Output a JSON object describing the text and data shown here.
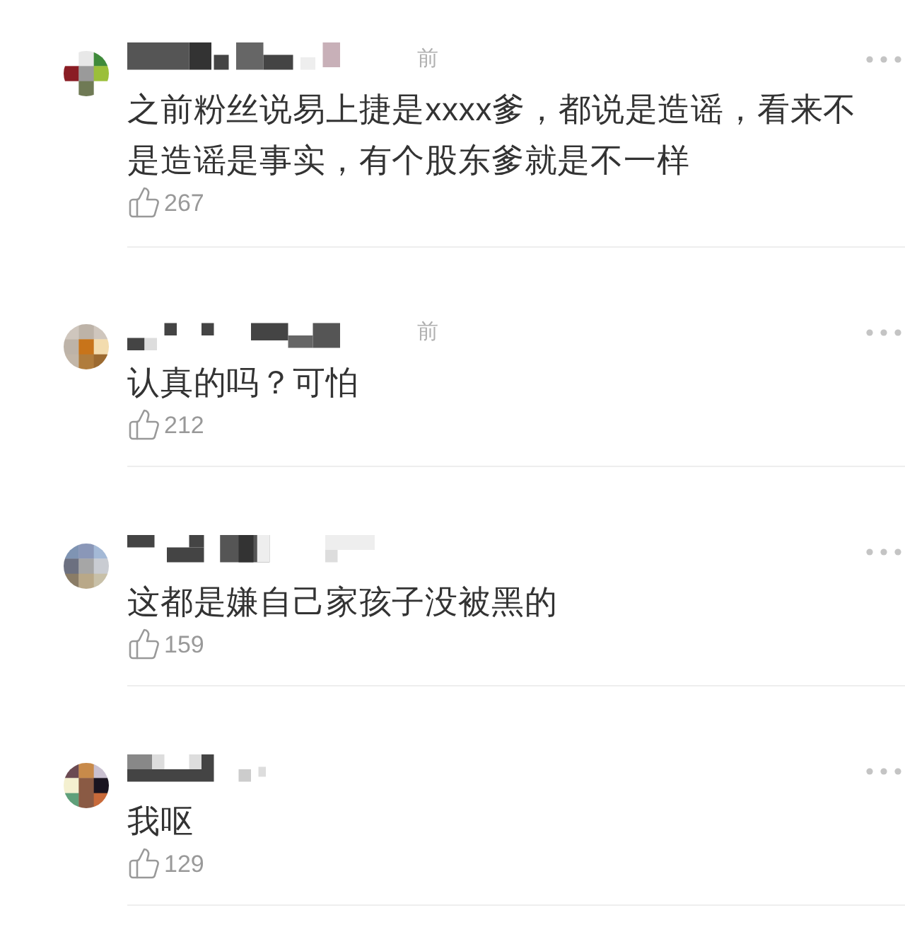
{
  "comments": [
    {
      "time": "前",
      "text": "之前粉丝说易上捷是xxxx爹，都说是造谣，看来不是造谣是事实，有个股东爹就是不一样",
      "likes": "267"
    },
    {
      "time": "前",
      "text": "认真的吗？可怕",
      "likes": "212"
    },
    {
      "text": "这都是嫌自己家孩子没被黑的",
      "likes": "159"
    },
    {
      "text": "我呕",
      "likes": "129"
    }
  ]
}
